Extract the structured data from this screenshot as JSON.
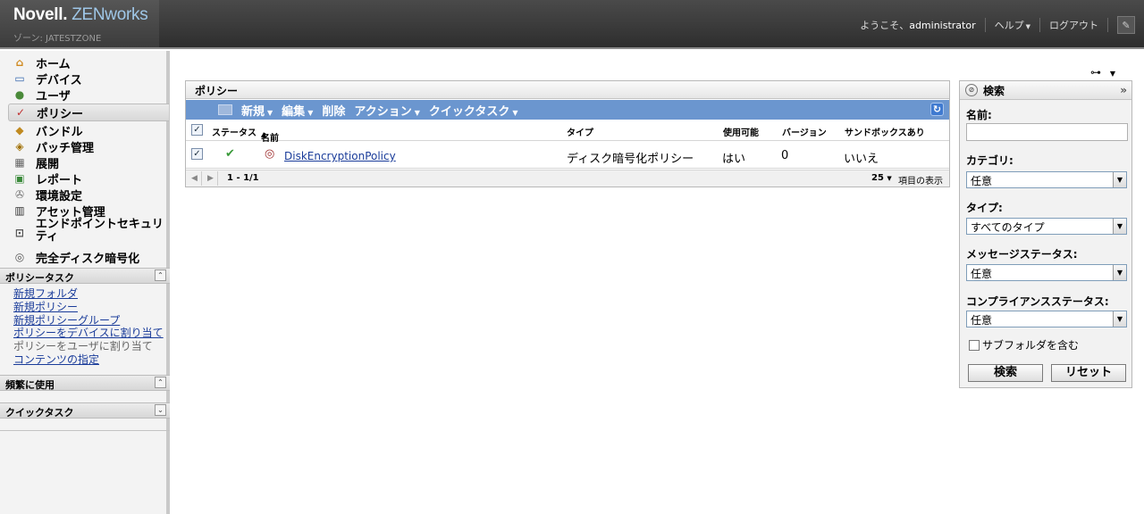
{
  "header": {
    "brand_novell": "Novell.",
    "brand_zenworks": "ZENworks",
    "zone": "ゾーン: JATESTZONE",
    "welcome_prefix": "ようこそ、",
    "welcome_user": "administrator",
    "help": "ヘルプ",
    "logout": "ログアウト"
  },
  "sidebar": {
    "nav": [
      {
        "label": "ホーム",
        "icon": "home-icon"
      },
      {
        "label": "デバイス",
        "icon": "monitor-icon"
      },
      {
        "label": "ユーザ",
        "icon": "users-icon"
      },
      {
        "label": "ポリシー",
        "icon": "policy-icon"
      },
      {
        "label": "バンドル",
        "icon": "bundle-icon"
      },
      {
        "label": "パッチ管理",
        "icon": "shield-icon"
      },
      {
        "label": "展開",
        "icon": "deploy-icon"
      },
      {
        "label": "レポート",
        "icon": "report-icon"
      },
      {
        "label": "環境設定",
        "icon": "wrench-icon"
      },
      {
        "label": "アセット管理",
        "icon": "asset-icon"
      },
      {
        "label": "エンドポイントセキュリティ",
        "icon": "lock-icon"
      },
      {
        "label": "完全ディスク暗号化",
        "icon": "disk-icon"
      }
    ],
    "active_index": 3,
    "policy_tasks_title": "ポリシータスク",
    "policy_tasks": [
      {
        "label": "新規フォルダ",
        "enabled": true
      },
      {
        "label": "新規ポリシー",
        "enabled": true
      },
      {
        "label": "新規ポリシーグループ",
        "enabled": true
      },
      {
        "label": "ポリシーをデバイスに割り当て",
        "enabled": true
      },
      {
        "label": "ポリシーをユーザに割り当て",
        "enabled": false
      },
      {
        "label": "コンテンツの指定",
        "enabled": true
      }
    ],
    "frequent_title": "頻繁に使用",
    "quick_tasks_title": "クイックタスク"
  },
  "policies": {
    "title": "ポリシー",
    "toolbar": {
      "new": "新規",
      "edit": "編集",
      "delete": "削除",
      "action": "アクション",
      "quick_task": "クイックタスク"
    },
    "columns": {
      "status": "ステータス",
      "name": "名前",
      "type": "タイプ",
      "enabled": "使用可能",
      "version": "バージョン",
      "sandbox": "サンドボックスあり"
    },
    "rows": [
      {
        "name": "DiskEncryptionPolicy",
        "type": "ディスク暗号化ポリシー",
        "enabled": "はい",
        "version": "0",
        "sandbox": "いいえ",
        "checked": true
      }
    ],
    "pager_range": "1 - 1/1",
    "page_size": "25",
    "page_size_label": "項目の表示"
  },
  "search": {
    "title": "検索",
    "name_label": "名前:",
    "name_value": "",
    "category_label": "カテゴリ:",
    "category_value": "任意",
    "type_label": "タイプ:",
    "type_value": "すべてのタイプ",
    "msg_status_label": "メッセージステータス:",
    "msg_status_value": "任意",
    "compliance_label": "コンプライアンスステータス:",
    "compliance_value": "任意",
    "subfolder_label": "サブフォルダを含む",
    "search_button": "検索",
    "reset_button": "リセット"
  }
}
